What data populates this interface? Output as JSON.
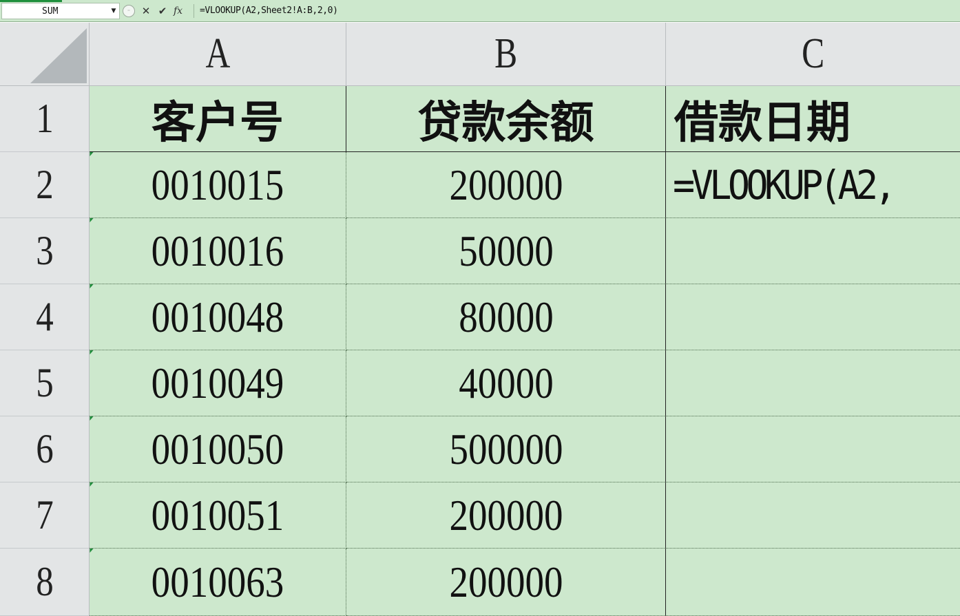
{
  "formula_bar": {
    "name_box": "SUM",
    "name_box_arrow": "▼",
    "cancel_glyph": "✕",
    "confirm_glyph": "✔",
    "fx_glyph": "fx",
    "formula": "=VLOOKUP(A2,Sheet2!A:B,2,0)"
  },
  "columns": [
    "A",
    "B",
    "C"
  ],
  "rows": [
    "1",
    "2",
    "3",
    "4",
    "5",
    "6",
    "7",
    "8"
  ],
  "header_row": {
    "a": "客户号",
    "b": "贷款余额",
    "c": "借款日期"
  },
  "data_rows": [
    {
      "a": "0010015",
      "b": "200000",
      "c": "=VLOOKUP(A2,"
    },
    {
      "a": "0010016",
      "b": "50000",
      "c": ""
    },
    {
      "a": "0010048",
      "b": "80000",
      "c": ""
    },
    {
      "a": "0010049",
      "b": "40000",
      "c": ""
    },
    {
      "a": "0010050",
      "b": "500000",
      "c": ""
    },
    {
      "a": "0010051",
      "b": "200000",
      "c": ""
    },
    {
      "a": "0010063",
      "b": "200000",
      "c": ""
    }
  ],
  "colors": {
    "cell_fill": "#cde8cd",
    "header_fill": "#e3e5e6",
    "error_marker": "#1f8b3a"
  }
}
